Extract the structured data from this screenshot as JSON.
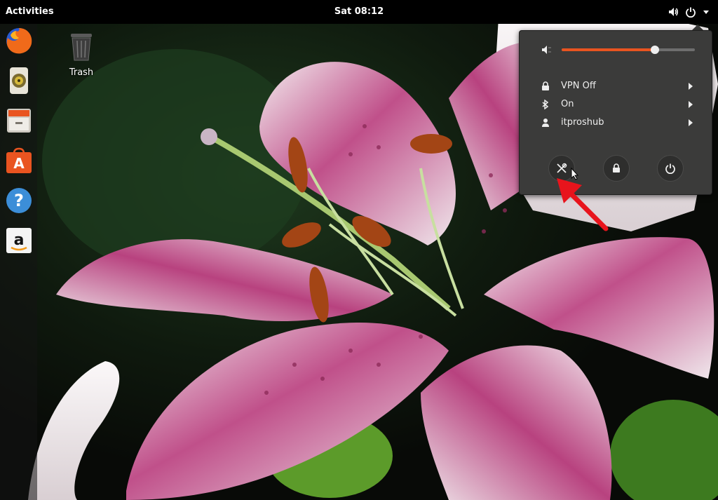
{
  "topbar": {
    "activities_label": "Activities",
    "clock_text": "Sat 08:12",
    "tray_icons": [
      "speaker-icon",
      "power-icon",
      "dropdown-arrow-icon"
    ]
  },
  "dock": {
    "apps": [
      "Firefox",
      "Rhythmbox",
      "Files",
      "Ubuntu Software",
      "Help",
      "Amazon"
    ]
  },
  "desktop": {
    "trash_label": "Trash"
  },
  "status_menu": {
    "volume_level": 0.7,
    "accent_color": "#e95420",
    "rows": [
      {
        "icon": "vpn-lock-icon",
        "label": "VPN Off"
      },
      {
        "icon": "bluetooth-icon",
        "label": "On"
      },
      {
        "icon": "user-icon",
        "label": "itproshub"
      }
    ],
    "buttons": [
      "settings-icon",
      "lock-icon",
      "power-off-icon"
    ]
  },
  "annotation": {
    "arrow_color": "#e8141c"
  }
}
